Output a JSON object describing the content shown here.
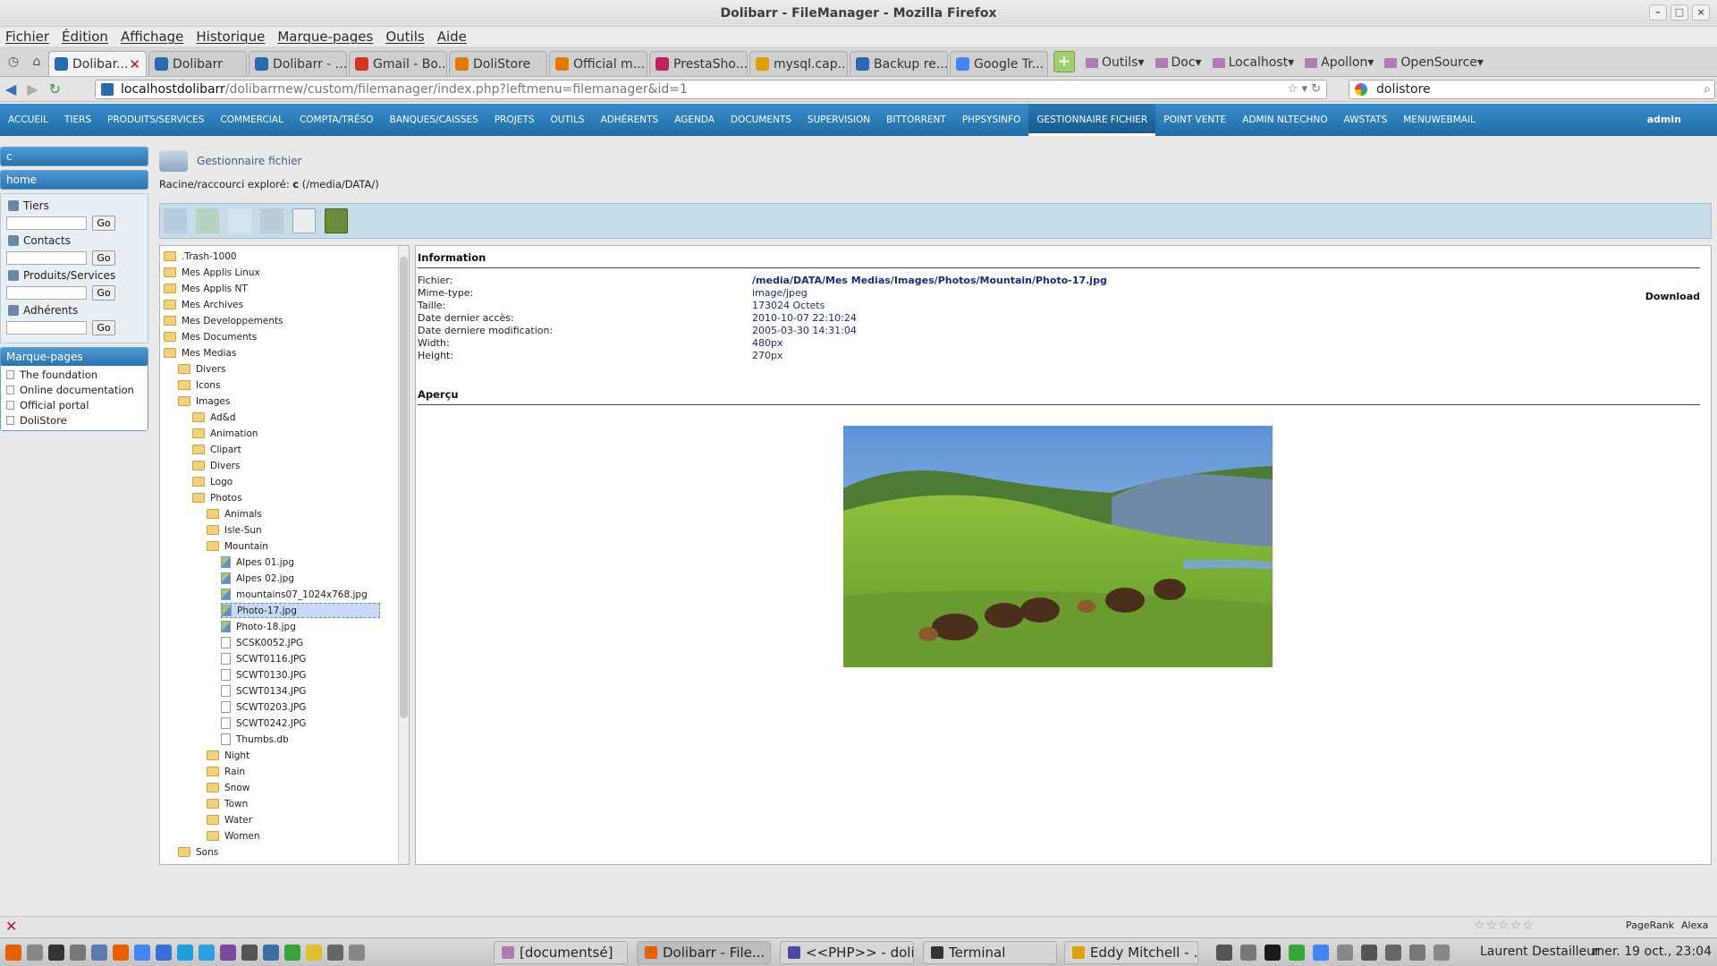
{
  "window": {
    "title": "Dolibarr - FileManager - Mozilla Firefox"
  },
  "menubar": [
    "Fichier",
    "Édition",
    "Affichage",
    "Historique",
    "Marque-pages",
    "Outils",
    "Aide"
  ],
  "tabs": [
    {
      "label": "Dolibar...",
      "color": "#2a6ab5",
      "active": true
    },
    {
      "label": "Dolibarr",
      "color": "#2a6ab5"
    },
    {
      "label": "Dolibarr - ...",
      "color": "#2a6ab5"
    },
    {
      "label": "Gmail - Bo...",
      "color": "#d93025"
    },
    {
      "label": "DoliStore",
      "color": "#e07b00"
    },
    {
      "label": "Official m...",
      "color": "#e07b00"
    },
    {
      "label": "PrestaSho...",
      "color": "#c02060"
    },
    {
      "label": "mysql.cap...",
      "color": "#e0a000"
    },
    {
      "label": "Backup re...",
      "color": "#2a6ab5"
    },
    {
      "label": "Google Tr...",
      "color": "#4285f4"
    }
  ],
  "bookmark_folders": [
    "Outils",
    "Doc",
    "Localhost",
    "Apollon",
    "OpenSource"
  ],
  "url": {
    "host": "localhostdolibarr",
    "path": "/dolibarrnew/custom/filemanager/index.php?leftmenu=filemanager&id=1"
  },
  "search": {
    "value": "dolistore"
  },
  "topmenu": [
    "ACCUEIL",
    "TIERS",
    "PRODUITS/SERVICES",
    "COMMERCIAL",
    "COMPTA/TRÉSO",
    "BANQUES/CAISSES",
    "PROJETS",
    "OUTILS",
    "ADHÉRENTS",
    "AGENDA",
    "DOCUMENTS",
    "SUPERVISION",
    "BITTORRENT",
    "PHPSYSINFO",
    "GESTIONNAIRE FICHIER",
    "POINT VENTE",
    "ADMIN NLTECHNO",
    "AWSTATS",
    "MENUWEBMAIL"
  ],
  "topmenu_selected": "GESTIONNAIRE FICHIER",
  "user": "admin",
  "sidebar": {
    "company": "c",
    "home": "home",
    "search_blocks": [
      {
        "label": "Tiers",
        "button": "Go"
      },
      {
        "label": "Contacts",
        "button": "Go"
      },
      {
        "label": "Produits/Services",
        "button": "Go"
      },
      {
        "label": "Adhérents",
        "button": "Go"
      }
    ],
    "bookmarks_title": "Marque-pages",
    "bookmarks": [
      "The foundation",
      "Online documentation",
      "Official portal",
      "DoliStore"
    ]
  },
  "page": {
    "title": "Gestionnaire fichier",
    "crumb_label": "Racine/raccourci exploré:",
    "crumb_root": "c",
    "crumb_path": "(/media/DATA/)"
  },
  "tree": [
    {
      "label": ".Trash-1000",
      "level": 0,
      "type": "folder"
    },
    {
      "label": "Mes Applis Linux",
      "level": 0,
      "type": "folder"
    },
    {
      "label": "Mes Applis NT",
      "level": 0,
      "type": "folder"
    },
    {
      "label": "Mes Archives",
      "level": 0,
      "type": "folder"
    },
    {
      "label": "Mes Developpements",
      "level": 0,
      "type": "folder"
    },
    {
      "label": "Mes Documents",
      "level": 0,
      "type": "folder"
    },
    {
      "label": "Mes Medias",
      "level": 0,
      "type": "folder"
    },
    {
      "label": "Divers",
      "level": 1,
      "type": "folder"
    },
    {
      "label": "Icons",
      "level": 1,
      "type": "folder"
    },
    {
      "label": "Images",
      "level": 1,
      "type": "folder"
    },
    {
      "label": "Ad&d",
      "level": 2,
      "type": "folder"
    },
    {
      "label": "Animation",
      "level": 2,
      "type": "folder"
    },
    {
      "label": "Clipart",
      "level": 2,
      "type": "folder"
    },
    {
      "label": "Divers",
      "level": 2,
      "type": "folder"
    },
    {
      "label": "Logo",
      "level": 2,
      "type": "folder"
    },
    {
      "label": "Photos",
      "level": 2,
      "type": "folder"
    },
    {
      "label": "Animals",
      "level": 3,
      "type": "folder"
    },
    {
      "label": "Isle-Sun",
      "level": 3,
      "type": "folder"
    },
    {
      "label": "Mountain",
      "level": 3,
      "type": "folder"
    },
    {
      "label": "Alpes 01.jpg",
      "level": 4,
      "type": "image"
    },
    {
      "label": "Alpes 02.jpg",
      "level": 4,
      "type": "image"
    },
    {
      "label": "mountains07_1024x768.jpg",
      "level": 4,
      "type": "image"
    },
    {
      "label": "Photo-17.jpg",
      "level": 4,
      "type": "image",
      "selected": true
    },
    {
      "label": "Photo-18.jpg",
      "level": 4,
      "type": "image"
    },
    {
      "label": "SCSK0052.JPG",
      "level": 4,
      "type": "file"
    },
    {
      "label": "SCWT0116.JPG",
      "level": 4,
      "type": "file"
    },
    {
      "label": "SCWT0130.JPG",
      "level": 4,
      "type": "file"
    },
    {
      "label": "SCWT0134.JPG",
      "level": 4,
      "type": "file"
    },
    {
      "label": "SCWT0203.JPG",
      "level": 4,
      "type": "file"
    },
    {
      "label": "SCWT0242.JPG",
      "level": 4,
      "type": "file"
    },
    {
      "label": "Thumbs.db",
      "level": 4,
      "type": "file"
    },
    {
      "label": "Night",
      "level": 3,
      "type": "folder"
    },
    {
      "label": "Rain",
      "level": 3,
      "type": "folder"
    },
    {
      "label": "Snow",
      "level": 3,
      "type": "folder"
    },
    {
      "label": "Town",
      "level": 3,
      "type": "folder"
    },
    {
      "label": "Water",
      "level": 3,
      "type": "folder"
    },
    {
      "label": "Women",
      "level": 3,
      "type": "folder"
    },
    {
      "label": "Sons",
      "level": 1,
      "type": "folder"
    }
  ],
  "info": {
    "heading": "Information",
    "download": "Download",
    "rows": [
      {
        "k": "Fichier:",
        "v": "/media/DATA/Mes Medias/Images/Photos/Mountain/Photo-17.jpg",
        "bold": true
      },
      {
        "k": "Mime-type:",
        "v": "image/jpeg"
      },
      {
        "k": "Taille:",
        "v": "173024 Octets"
      },
      {
        "k": "Date dernier accès:",
        "v": "2010-10-07 22:10:24"
      },
      {
        "k": "Date derniere modification:",
        "v": "2005-03-30 14:31:04"
      },
      {
        "k": "Width:",
        "v": "480px"
      },
      {
        "k": "Height:",
        "v": "270px"
      }
    ],
    "preview_heading": "Aperçu"
  },
  "statusbar": {
    "pagerank": "PageRank",
    "alexa": "Alexa"
  },
  "taskbar": {
    "tasks": [
      {
        "label": "[documentsé]",
        "color": "#b07bb3"
      },
      {
        "label": "Dolibarr - File...",
        "color": "#e66000",
        "active": true
      },
      {
        "label": "<<PHP>> - doli...",
        "color": "#4a4aa0"
      },
      {
        "label": "Terminal",
        "color": "#333333"
      },
      {
        "label": "Eddy Mitchell - ...",
        "color": "#e0a000"
      }
    ],
    "user": "Laurent Destailleur",
    "clock": "mer. 19 oct., 23:04"
  }
}
